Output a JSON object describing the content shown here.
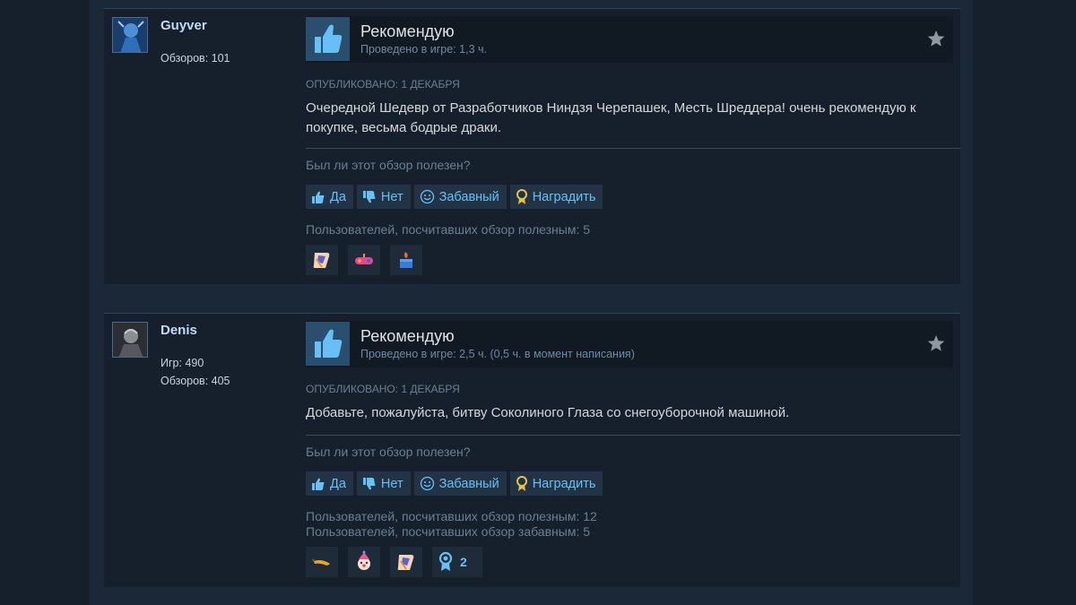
{
  "reviews": [
    {
      "author": {
        "name": "Guyver",
        "stats": [
          "Обзоров: 101"
        ]
      },
      "verdict": "Рекомендую",
      "hours": "Проведено в игре: 1,3 ч.",
      "posted": "Опубликовано: 1 декабря",
      "text": "Очередной Шедевр от Разработчиков Ниндзя Черепашек, Месть Шреддера! очень рекомендую к покупке, весьма бодрые драки.",
      "helpful_question": "Был ли этот обзор полезен?",
      "buttons": {
        "yes": "Да",
        "no": "Нет",
        "funny": "Забавный",
        "award": "Наградить"
      },
      "stats_lines": [
        "Пользователей, посчитавших обзор полезным: 5"
      ],
      "awards": [
        "scroll-award-icon",
        "controller-award-icon",
        "cake-award-icon"
      ]
    },
    {
      "author": {
        "name": "Denis",
        "stats": [
          "Игр: 490",
          "Обзоров: 405"
        ]
      },
      "verdict": "Рекомендую",
      "hours": "Проведено в игре: 2,5 ч. (0,5 ч. в момент написания)",
      "posted": "Опубликовано: 1 декабря",
      "text": "Добавьте, пожалуйста, битву Соколиного Глаза со снегоуборочной машиной.",
      "helpful_question": "Был ли этот обзор полезен?",
      "buttons": {
        "yes": "Да",
        "no": "Нет",
        "funny": "Забавный",
        "award": "Наградить"
      },
      "stats_lines": [
        "Пользователей, посчитавших обзор полезным: 12",
        "Пользователей, посчитавших обзор забавным: 5"
      ],
      "awards": [
        "banana-award-icon",
        "clown-award-icon",
        "scroll-award-icon",
        "medal-award-icon"
      ],
      "award_count": "2"
    }
  ],
  "colors": {
    "background": "#1b2838",
    "panel": "#16202d",
    "link": "#67c1f5",
    "thumb_bg": "#2a4f6e"
  }
}
